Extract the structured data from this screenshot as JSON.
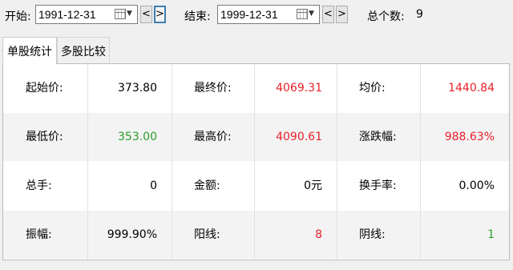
{
  "toolbar": {
    "start_label": "开始:",
    "start_date": "1991-12-31",
    "prev_label": "<",
    "next_label": ">",
    "end_label": "结束:",
    "end_date": "1999-12-31",
    "end_prev_label": "<",
    "end_next_label": ">",
    "count_label": "总个数:",
    "count_value": "9"
  },
  "tabs": [
    {
      "label": "单股统计",
      "active": true
    },
    {
      "label": "多股比较",
      "active": false
    }
  ],
  "stats": [
    [
      {
        "label": "起始价:",
        "value": "373.80",
        "color": "#000000"
      },
      {
        "label": "最终价:",
        "value": "4069.31",
        "color": "#e8202a"
      },
      {
        "label": "均价:",
        "value": "1440.84",
        "color": "#e8202a"
      }
    ],
    [
      {
        "label": "最低价:",
        "value": "353.00",
        "color": "#2a9d2a"
      },
      {
        "label": "最高价:",
        "value": "4090.61",
        "color": "#e8202a"
      },
      {
        "label": "涨跌幅:",
        "value": "988.63%",
        "color": "#e8202a"
      }
    ],
    [
      {
        "label": "总手:",
        "value": "0",
        "color": "#000000"
      },
      {
        "label": "金额:",
        "value": "0元",
        "color": "#000000"
      },
      {
        "label": "换手率:",
        "value": "0.00%",
        "color": "#000000"
      }
    ],
    [
      {
        "label": "振幅:",
        "value": "999.90%",
        "color": "#000000"
      },
      {
        "label": "阳线:",
        "value": "8",
        "color": "#e8202a"
      },
      {
        "label": "阴线:",
        "value": "1",
        "color": "#2a9d2a"
      }
    ]
  ],
  "icons": {
    "calendar": "calendar-icon",
    "dropdown": "chevron-down-icon"
  }
}
